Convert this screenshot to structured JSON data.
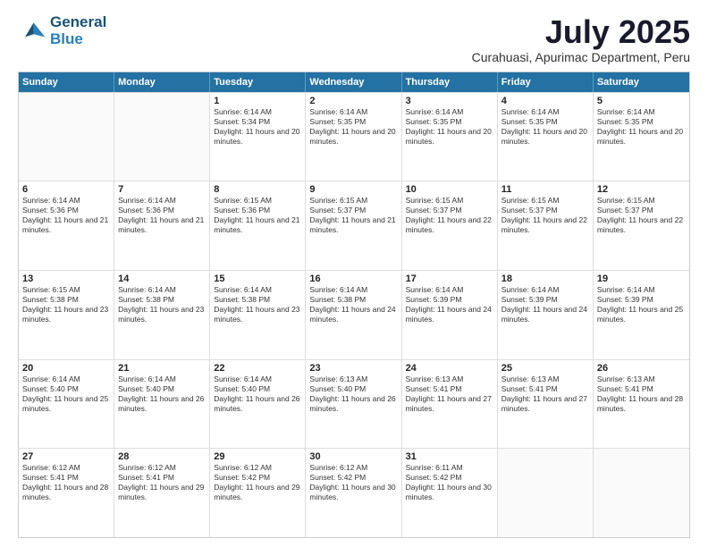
{
  "logo": {
    "line1": "General",
    "line2": "Blue"
  },
  "title": "July 2025",
  "subtitle": "Curahuasi, Apurimac Department, Peru",
  "header_days": [
    "Sunday",
    "Monday",
    "Tuesday",
    "Wednesday",
    "Thursday",
    "Friday",
    "Saturday"
  ],
  "weeks": [
    [
      {
        "day": "",
        "info": ""
      },
      {
        "day": "",
        "info": ""
      },
      {
        "day": "1",
        "info": "Sunrise: 6:14 AM\nSunset: 5:34 PM\nDaylight: 11 hours and 20 minutes."
      },
      {
        "day": "2",
        "info": "Sunrise: 6:14 AM\nSunset: 5:35 PM\nDaylight: 11 hours and 20 minutes."
      },
      {
        "day": "3",
        "info": "Sunrise: 6:14 AM\nSunset: 5:35 PM\nDaylight: 11 hours and 20 minutes."
      },
      {
        "day": "4",
        "info": "Sunrise: 6:14 AM\nSunset: 5:35 PM\nDaylight: 11 hours and 20 minutes."
      },
      {
        "day": "5",
        "info": "Sunrise: 6:14 AM\nSunset: 5:35 PM\nDaylight: 11 hours and 20 minutes."
      }
    ],
    [
      {
        "day": "6",
        "info": "Sunrise: 6:14 AM\nSunset: 5:36 PM\nDaylight: 11 hours and 21 minutes."
      },
      {
        "day": "7",
        "info": "Sunrise: 6:14 AM\nSunset: 5:36 PM\nDaylight: 11 hours and 21 minutes."
      },
      {
        "day": "8",
        "info": "Sunrise: 6:15 AM\nSunset: 5:36 PM\nDaylight: 11 hours and 21 minutes."
      },
      {
        "day": "9",
        "info": "Sunrise: 6:15 AM\nSunset: 5:37 PM\nDaylight: 11 hours and 21 minutes."
      },
      {
        "day": "10",
        "info": "Sunrise: 6:15 AM\nSunset: 5:37 PM\nDaylight: 11 hours and 22 minutes."
      },
      {
        "day": "11",
        "info": "Sunrise: 6:15 AM\nSunset: 5:37 PM\nDaylight: 11 hours and 22 minutes."
      },
      {
        "day": "12",
        "info": "Sunrise: 6:15 AM\nSunset: 5:37 PM\nDaylight: 11 hours and 22 minutes."
      }
    ],
    [
      {
        "day": "13",
        "info": "Sunrise: 6:15 AM\nSunset: 5:38 PM\nDaylight: 11 hours and 23 minutes."
      },
      {
        "day": "14",
        "info": "Sunrise: 6:14 AM\nSunset: 5:38 PM\nDaylight: 11 hours and 23 minutes."
      },
      {
        "day": "15",
        "info": "Sunrise: 6:14 AM\nSunset: 5:38 PM\nDaylight: 11 hours and 23 minutes."
      },
      {
        "day": "16",
        "info": "Sunrise: 6:14 AM\nSunset: 5:38 PM\nDaylight: 11 hours and 24 minutes."
      },
      {
        "day": "17",
        "info": "Sunrise: 6:14 AM\nSunset: 5:39 PM\nDaylight: 11 hours and 24 minutes."
      },
      {
        "day": "18",
        "info": "Sunrise: 6:14 AM\nSunset: 5:39 PM\nDaylight: 11 hours and 24 minutes."
      },
      {
        "day": "19",
        "info": "Sunrise: 6:14 AM\nSunset: 5:39 PM\nDaylight: 11 hours and 25 minutes."
      }
    ],
    [
      {
        "day": "20",
        "info": "Sunrise: 6:14 AM\nSunset: 5:40 PM\nDaylight: 11 hours and 25 minutes."
      },
      {
        "day": "21",
        "info": "Sunrise: 6:14 AM\nSunset: 5:40 PM\nDaylight: 11 hours and 26 minutes."
      },
      {
        "day": "22",
        "info": "Sunrise: 6:14 AM\nSunset: 5:40 PM\nDaylight: 11 hours and 26 minutes."
      },
      {
        "day": "23",
        "info": "Sunrise: 6:13 AM\nSunset: 5:40 PM\nDaylight: 11 hours and 26 minutes."
      },
      {
        "day": "24",
        "info": "Sunrise: 6:13 AM\nSunset: 5:41 PM\nDaylight: 11 hours and 27 minutes."
      },
      {
        "day": "25",
        "info": "Sunrise: 6:13 AM\nSunset: 5:41 PM\nDaylight: 11 hours and 27 minutes."
      },
      {
        "day": "26",
        "info": "Sunrise: 6:13 AM\nSunset: 5:41 PM\nDaylight: 11 hours and 28 minutes."
      }
    ],
    [
      {
        "day": "27",
        "info": "Sunrise: 6:12 AM\nSunset: 5:41 PM\nDaylight: 11 hours and 28 minutes."
      },
      {
        "day": "28",
        "info": "Sunrise: 6:12 AM\nSunset: 5:41 PM\nDaylight: 11 hours and 29 minutes."
      },
      {
        "day": "29",
        "info": "Sunrise: 6:12 AM\nSunset: 5:42 PM\nDaylight: 11 hours and 29 minutes."
      },
      {
        "day": "30",
        "info": "Sunrise: 6:12 AM\nSunset: 5:42 PM\nDaylight: 11 hours and 30 minutes."
      },
      {
        "day": "31",
        "info": "Sunrise: 6:11 AM\nSunset: 5:42 PM\nDaylight: 11 hours and 30 minutes."
      },
      {
        "day": "",
        "info": ""
      },
      {
        "day": "",
        "info": ""
      }
    ]
  ]
}
